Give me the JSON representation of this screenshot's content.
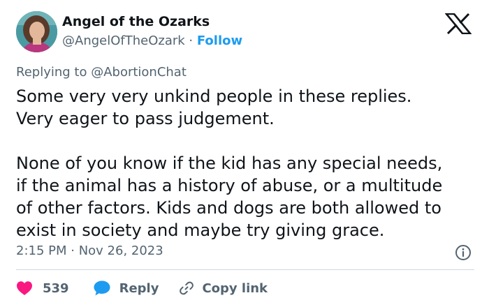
{
  "author": {
    "display_name": "Angel of the Ozarks",
    "handle": "@AngelOfTheOzark",
    "separator": " · ",
    "follow_label": "Follow",
    "avatar_icon": "profile-photo"
  },
  "brand": {
    "logo_icon": "x-logo"
  },
  "reply_context": {
    "prefix": "Replying to ",
    "mention": "@AbortionChat"
  },
  "tweet": {
    "paragraphs": [
      "Some very very unkind people in these replies.\nVery eager to pass judgement.",
      "None of you know if the kid has any special needs,\nif the animal has a history of abuse, or a multitude\nof other factors. Kids and dogs are both allowed to\nexist in society and maybe try giving grace."
    ],
    "timestamp": "2:15 PM · Nov 26, 2023",
    "info_icon": "info-icon"
  },
  "actions": {
    "like_count": "539",
    "reply_label": "Reply",
    "copy_link_label": "Copy link"
  },
  "colors": {
    "like": "#f91880",
    "reply": "#1d9bf0",
    "link": "#1d9bf0",
    "secondary_text": "#536471",
    "primary_text": "#0f1419",
    "divider": "#cfd9de"
  }
}
